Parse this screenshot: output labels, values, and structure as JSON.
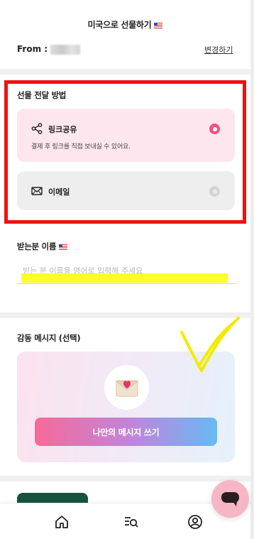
{
  "header": {
    "title": "미국으로 선물하기",
    "from_label": "From :",
    "change_link": "변경하기"
  },
  "delivery": {
    "title": "선물 전달 방법",
    "options": [
      {
        "label": "링크공유",
        "description": "결제 후 링크를 직접 보내실 수 있어요.",
        "icon": "share-icon",
        "selected": true
      },
      {
        "label": "이메일",
        "icon": "mail-icon",
        "selected": false
      }
    ]
  },
  "recipient": {
    "title": "받는분 이름",
    "placeholder": "받는 분 이름을 영어로 입력해 주세요"
  },
  "message": {
    "title": "감동 메시지 (선택)",
    "write_button": "나만의 메시지 쓰기",
    "icon": "envelope-heart-icon"
  },
  "nav": {
    "items": [
      {
        "icon": "home-icon"
      },
      {
        "icon": "search-list-icon"
      },
      {
        "icon": "account-icon"
      }
    ]
  },
  "chat": {
    "icon": "chat-icon"
  },
  "colors": {
    "accent_pink": "#f0517f",
    "selected_bg": "#fde6ee",
    "annotation_red": "#ee1111",
    "annotation_yellow": "#ffff00",
    "product_green": "#15543a"
  }
}
